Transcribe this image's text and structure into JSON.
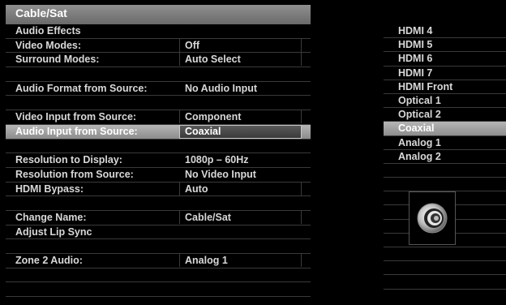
{
  "header": {
    "title": "Cable/Sat"
  },
  "menu": [
    {
      "label": "Audio Effects",
      "value": "",
      "box": false,
      "selected": false
    },
    {
      "label": "Video Modes:",
      "value": "Off",
      "box": true,
      "selected": false
    },
    {
      "label": "Surround Modes:",
      "value": "Auto Select",
      "box": true,
      "selected": false
    },
    {
      "label": "",
      "value": "",
      "box": false,
      "selected": false
    },
    {
      "label": "Audio Format from Source:",
      "value": "No Audio Input",
      "box": false,
      "selected": false
    },
    {
      "label": "",
      "value": "",
      "box": false,
      "selected": false
    },
    {
      "label": "Video Input from Source:",
      "value": "Component",
      "box": true,
      "selected": false
    },
    {
      "label": "Audio Input from Source:",
      "value": "Coaxial",
      "box": true,
      "selected": true
    },
    {
      "label": "",
      "value": "",
      "box": false,
      "selected": false
    },
    {
      "label": "Resolution to Display:",
      "value": "1080p – 60Hz",
      "box": false,
      "selected": false
    },
    {
      "label": "Resolution from Source:",
      "value": "No Video Input",
      "box": false,
      "selected": false
    },
    {
      "label": "HDMI Bypass:",
      "value": "Auto",
      "box": true,
      "selected": false
    },
    {
      "label": "",
      "value": "",
      "box": false,
      "selected": false
    },
    {
      "label": "Change Name:",
      "value": "Cable/Sat",
      "box": true,
      "selected": false
    },
    {
      "label": "Adjust Lip Sync",
      "value": "",
      "box": false,
      "selected": false
    },
    {
      "label": "",
      "value": "",
      "box": false,
      "selected": false
    },
    {
      "label": "Zone 2 Audio:",
      "value": "Analog 1",
      "box": true,
      "selected": false
    },
    {
      "label": "",
      "value": "",
      "box": false,
      "selected": false
    },
    {
      "label": "",
      "value": "",
      "box": false,
      "selected": false
    }
  ],
  "submenu": [
    {
      "label": "HDMI 4",
      "selected": false
    },
    {
      "label": "HDMI 5",
      "selected": false
    },
    {
      "label": "HDMI 6",
      "selected": false
    },
    {
      "label": "HDMI 7",
      "selected": false
    },
    {
      "label": "HDMI Front",
      "selected": false
    },
    {
      "label": "Optical 1",
      "selected": false
    },
    {
      "label": "Optical 2",
      "selected": false
    },
    {
      "label": "Coaxial",
      "selected": true
    },
    {
      "label": "Analog 1",
      "selected": false
    },
    {
      "label": "Analog 2",
      "selected": false
    },
    {
      "label": "",
      "selected": false
    },
    {
      "label": "",
      "selected": false
    },
    {
      "label": "",
      "selected": false
    },
    {
      "label": "",
      "selected": false
    },
    {
      "label": "",
      "selected": false
    },
    {
      "label": "",
      "selected": false
    },
    {
      "label": "",
      "selected": false
    },
    {
      "label": "",
      "selected": false
    },
    {
      "label": "",
      "selected": false
    }
  ],
  "connector_icon": "coaxial-connector-icon"
}
